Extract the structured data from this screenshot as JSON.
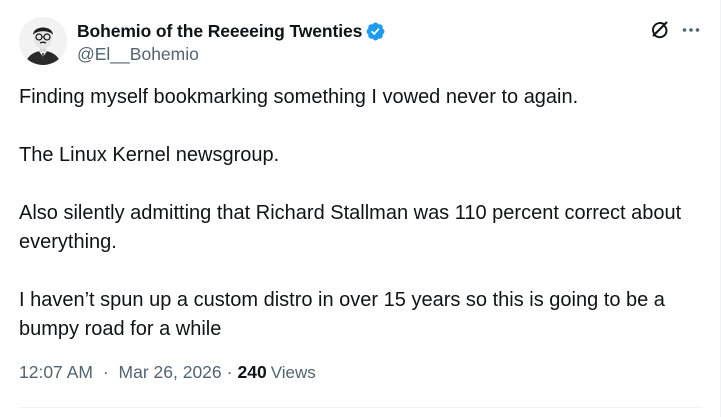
{
  "author": {
    "display_name": "Bohemio of the Reeeeing Twenties",
    "handle": "@El__Bohemio",
    "verified": true,
    "verified_color": "#1d9bf0"
  },
  "header": {
    "grok_icon": "grok-icon",
    "more_icon": "more-options-icon"
  },
  "tweet": {
    "paragraphs": [
      "Finding myself bookmarking something I vowed never to again.",
      "The Linux Kernel newsgroup.",
      "Also silently admitting that Richard Stallman was 110 percent correct about everything.",
      "I haven’t spun up a custom distro in over 15 years so this is going to be a bumpy road for a while"
    ]
  },
  "meta": {
    "time": "12:07 AM",
    "separator": "·",
    "date": "Mar 26, 2026",
    "views_count": "240",
    "views_label": "Views"
  },
  "colors": {
    "text_primary": "#0f1419",
    "text_secondary": "#536471",
    "divider": "#eff3f4"
  }
}
